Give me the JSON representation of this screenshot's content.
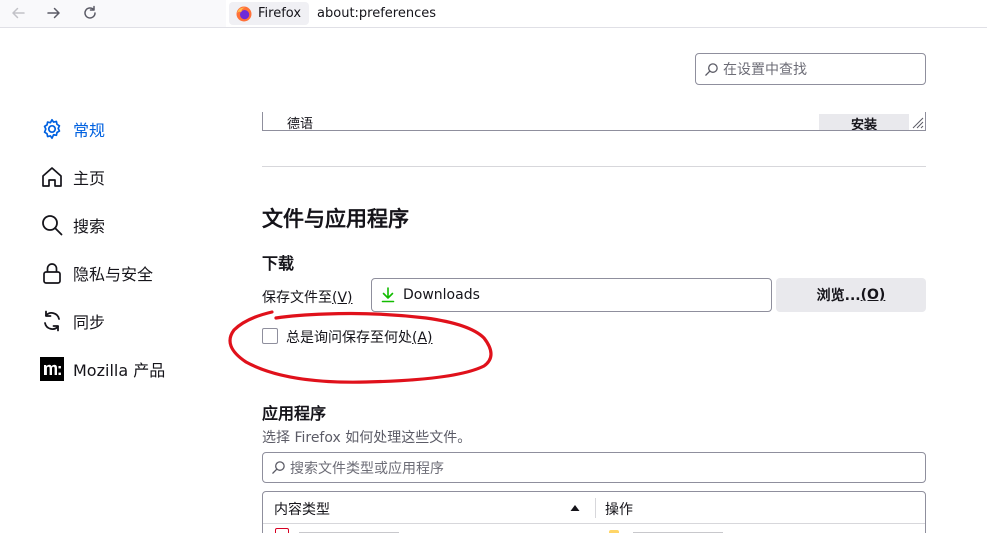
{
  "browser": {
    "identity_label": "Firefox",
    "url": "about:preferences"
  },
  "search": {
    "placeholder": "在设置中查找"
  },
  "sidebar": {
    "items": [
      {
        "label": "常规",
        "icon": "gear-icon",
        "selected": true
      },
      {
        "label": "主页",
        "icon": "home-icon",
        "selected": false
      },
      {
        "label": "搜索",
        "icon": "search-icon",
        "selected": false
      },
      {
        "label": "隐私与安全",
        "icon": "lock-icon",
        "selected": false
      },
      {
        "label": "同步",
        "icon": "sync-icon",
        "selected": false
      },
      {
        "label": "Mozilla 产品",
        "icon": "mozilla-icon",
        "selected": false
      }
    ]
  },
  "language_box": {
    "item_label": "德语",
    "install_label": "安装"
  },
  "files_section": {
    "title": "文件与应用程序",
    "downloads_title": "下载",
    "save_to_label": "保存文件至",
    "save_to_accesskey": "(V)",
    "download_folder": "Downloads",
    "browse_label": "浏览...",
    "browse_accesskey": "(O)",
    "always_ask_label": "总是询问保存至何处",
    "always_ask_accesskey": "(A)",
    "always_ask_checked": false
  },
  "applications_section": {
    "title": "应用程序",
    "description": "选择 Firefox 如何处理这些文件。",
    "search_placeholder": "搜索文件类型或应用程序",
    "columns": {
      "content_type": "内容类型",
      "action": "操作"
    }
  },
  "colors": {
    "accent": "#0061e0",
    "annotation": "#e0111b"
  }
}
